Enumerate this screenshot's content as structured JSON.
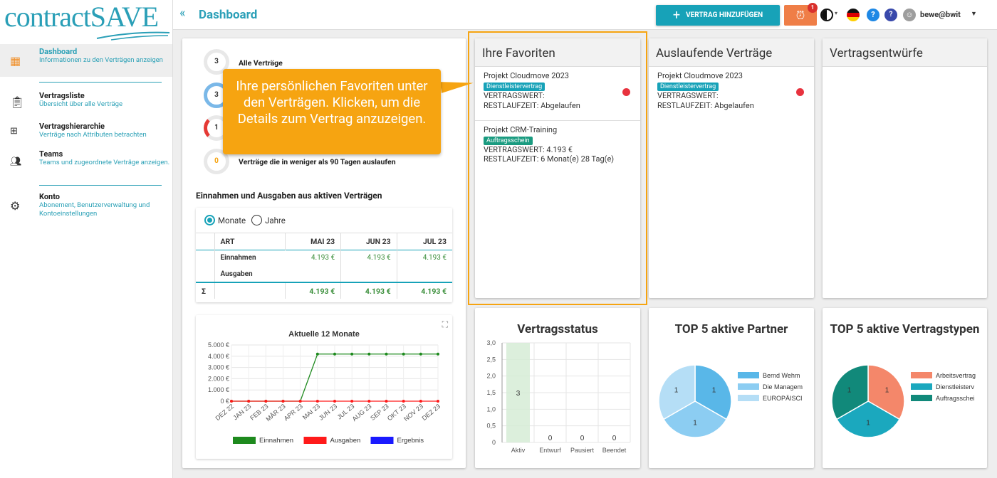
{
  "app": {
    "logo_text": "contractSAVE",
    "page_title": "Dashboard"
  },
  "sidebar": {
    "items": [
      {
        "label": "Dashboard",
        "sub": "Informationen zu den Verträgen anzeigen"
      },
      {
        "label": "Vertragsliste",
        "sub": "Übersicht über alle Verträge"
      },
      {
        "label": "Vertragshierarchie",
        "sub": "Verträge nach Attributen betrachten"
      },
      {
        "label": "Teams",
        "sub": "Teams und zugeordnete Verträge anzeigen."
      },
      {
        "label": "Konto",
        "sub": "Abonement, Benutzerverwaltung und Kontoeinstellungen"
      }
    ]
  },
  "topbar": {
    "add_contract": "VERTRAG HINZUFÜGEN",
    "alarm_badge": "1",
    "user": "bewe@bwit"
  },
  "stats": [
    {
      "count": "3",
      "label": "Alle Verträge"
    },
    {
      "count": "3",
      "label": ""
    },
    {
      "count": "1",
      "label": ""
    },
    {
      "count": "0",
      "label": "Verträge die in weniger als 90 Tagen auslaufen"
    }
  ],
  "tooltip": "Ihre persönlichen Favoriten unter den Verträgen. Klicken, um die Details zum Vertrag anzuzeigen.",
  "income": {
    "title": "Einnahmen und Ausgaben aus aktiven Verträgen",
    "radio_months": "Monate",
    "radio_years": "Jahre",
    "headers": [
      "ART",
      "MAI 23",
      "JUN 23",
      "JUL 23"
    ],
    "rows": [
      {
        "label": "Einnahmen",
        "values": [
          "4.193 €",
          "4.193 €",
          "4.193 €"
        ]
      },
      {
        "label": "Ausgaben",
        "values": [
          "",
          "",
          ""
        ]
      }
    ],
    "sum_label": "Σ",
    "sums": [
      "4.193 €",
      "4.193 €",
      "4.193 €"
    ]
  },
  "favorites": {
    "title": "Ihre Favoriten",
    "items": [
      {
        "name": "Projekt Cloudmove 2023",
        "tag": "Dienstleistervertrag",
        "value": "VERTRAGSWERT:",
        "rest": "RESTLAUFZEIT: Abgelaufen"
      },
      {
        "name": "Projekt CRM-Training",
        "tag": "Auftragsschein",
        "value": "VERTRAGSWERT: 4.193 €",
        "rest": "RESTLAUFZEIT: 6 Monat(e) 28 Tag(e)"
      }
    ]
  },
  "expiring": {
    "title": "Auslaufende Verträge",
    "items": [
      {
        "name": "Projekt Cloudmove 2023",
        "tag": "Dienstleistervertrag",
        "value": "VERTRAGSWERT:",
        "rest": "RESTLAUFZEIT: Abgelaufen"
      }
    ]
  },
  "drafts": {
    "title": "Vertragsentwürfe"
  },
  "colors": {
    "accent": "#17a2b8",
    "alarm": "#ef7e47",
    "tooltip": "#f6a411",
    "highlight_border": "#f6a411"
  },
  "chart_data": [
    {
      "type": "line",
      "title": "Aktuelle 12 Monate",
      "x": [
        "DEZ 22",
        "JAN 23",
        "FEB 23",
        "MÄR 23",
        "APR 23",
        "MAI 23",
        "JUN 23",
        "JUL 23",
        "AUG 23",
        "SEP 23",
        "OKT 23",
        "NOV 23",
        "DEZ 23"
      ],
      "ylim": [
        0,
        5000
      ],
      "yticks": [
        "0 €",
        "1.000 €",
        "2.000 €",
        "3.000 €",
        "4.000 €",
        "5.000 €"
      ],
      "series": [
        {
          "name": "Einnahmen",
          "color": "#1e8a1e",
          "values": [
            0,
            0,
            0,
            0,
            0,
            4193,
            4193,
            4193,
            4193,
            4193,
            4193,
            4193,
            4193
          ]
        },
        {
          "name": "Ausgaben",
          "color": "#ff1a1a",
          "values": [
            0,
            0,
            0,
            0,
            0,
            0,
            0,
            0,
            0,
            0,
            0,
            0,
            0
          ]
        },
        {
          "name": "Ergebnis",
          "color": "#1a1aff",
          "values": []
        }
      ]
    },
    {
      "type": "bar",
      "title": "Vertragsstatus",
      "categories": [
        "Aktiv",
        "Entwurf",
        "Pausiert",
        "Beendet"
      ],
      "values": [
        3,
        0,
        0,
        0
      ],
      "ylim": [
        0,
        3
      ],
      "yticks": [
        "0",
        "0,5",
        "1,0",
        "1,5",
        "2,0",
        "2,5",
        "3,0"
      ]
    },
    {
      "type": "pie",
      "title": "TOP 5 aktive Partner",
      "categories": [
        "Bernd Wehm",
        "Die Managem",
        "EUROPÄISCI"
      ],
      "values": [
        1,
        1,
        1
      ],
      "colors": [
        "#59b7e8",
        "#8ccdf2",
        "#b5def6"
      ]
    },
    {
      "type": "pie",
      "title": "TOP 5 aktive Vertragstypen",
      "categories": [
        "Arbeitsvertrag",
        "Dienstleisterv",
        "Auftragsschei"
      ],
      "values": [
        1,
        1,
        1
      ],
      "colors": [
        "#f4876a",
        "#1ba8be",
        "#11897a"
      ]
    }
  ]
}
